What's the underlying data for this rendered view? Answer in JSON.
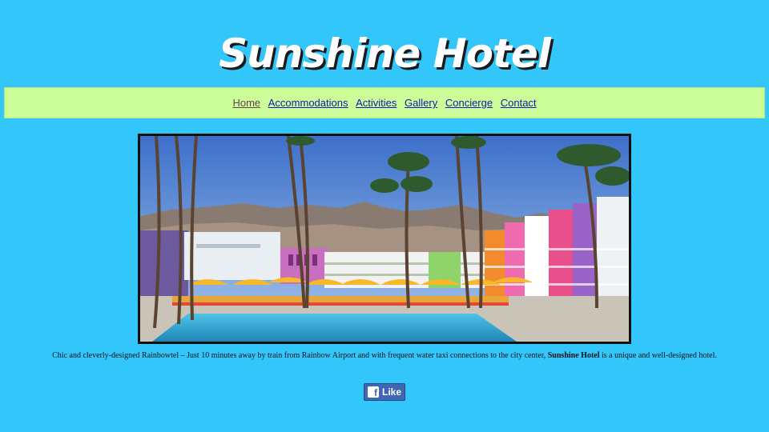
{
  "header": {
    "title": "Sunshine Hotel"
  },
  "nav": {
    "items": [
      {
        "label": "Home",
        "active": true
      },
      {
        "label": "Accommodations",
        "active": false
      },
      {
        "label": "Activities",
        "active": false
      },
      {
        "label": "Gallery",
        "active": false
      },
      {
        "label": "Concierge",
        "active": false
      },
      {
        "label": "Contact",
        "active": false
      }
    ]
  },
  "hero": {
    "icon": "hotel-photo"
  },
  "caption": {
    "text_before": "Chic and cleverly-designed Rainbowtel – Just 10 minutes away by train from Rainbow Airport and with frequent water taxi connections to the city center, ",
    "bold": "Sunshine Hotel",
    "text_after": " is a unique and well-designed hotel."
  },
  "like": {
    "label": "Like",
    "icon": "facebook-icon"
  },
  "colors": {
    "background": "#33c6fb",
    "nav_background": "#ccff99",
    "link": "#1515b8",
    "active_link": "#6b3e56",
    "like_button": "#4267b2"
  }
}
